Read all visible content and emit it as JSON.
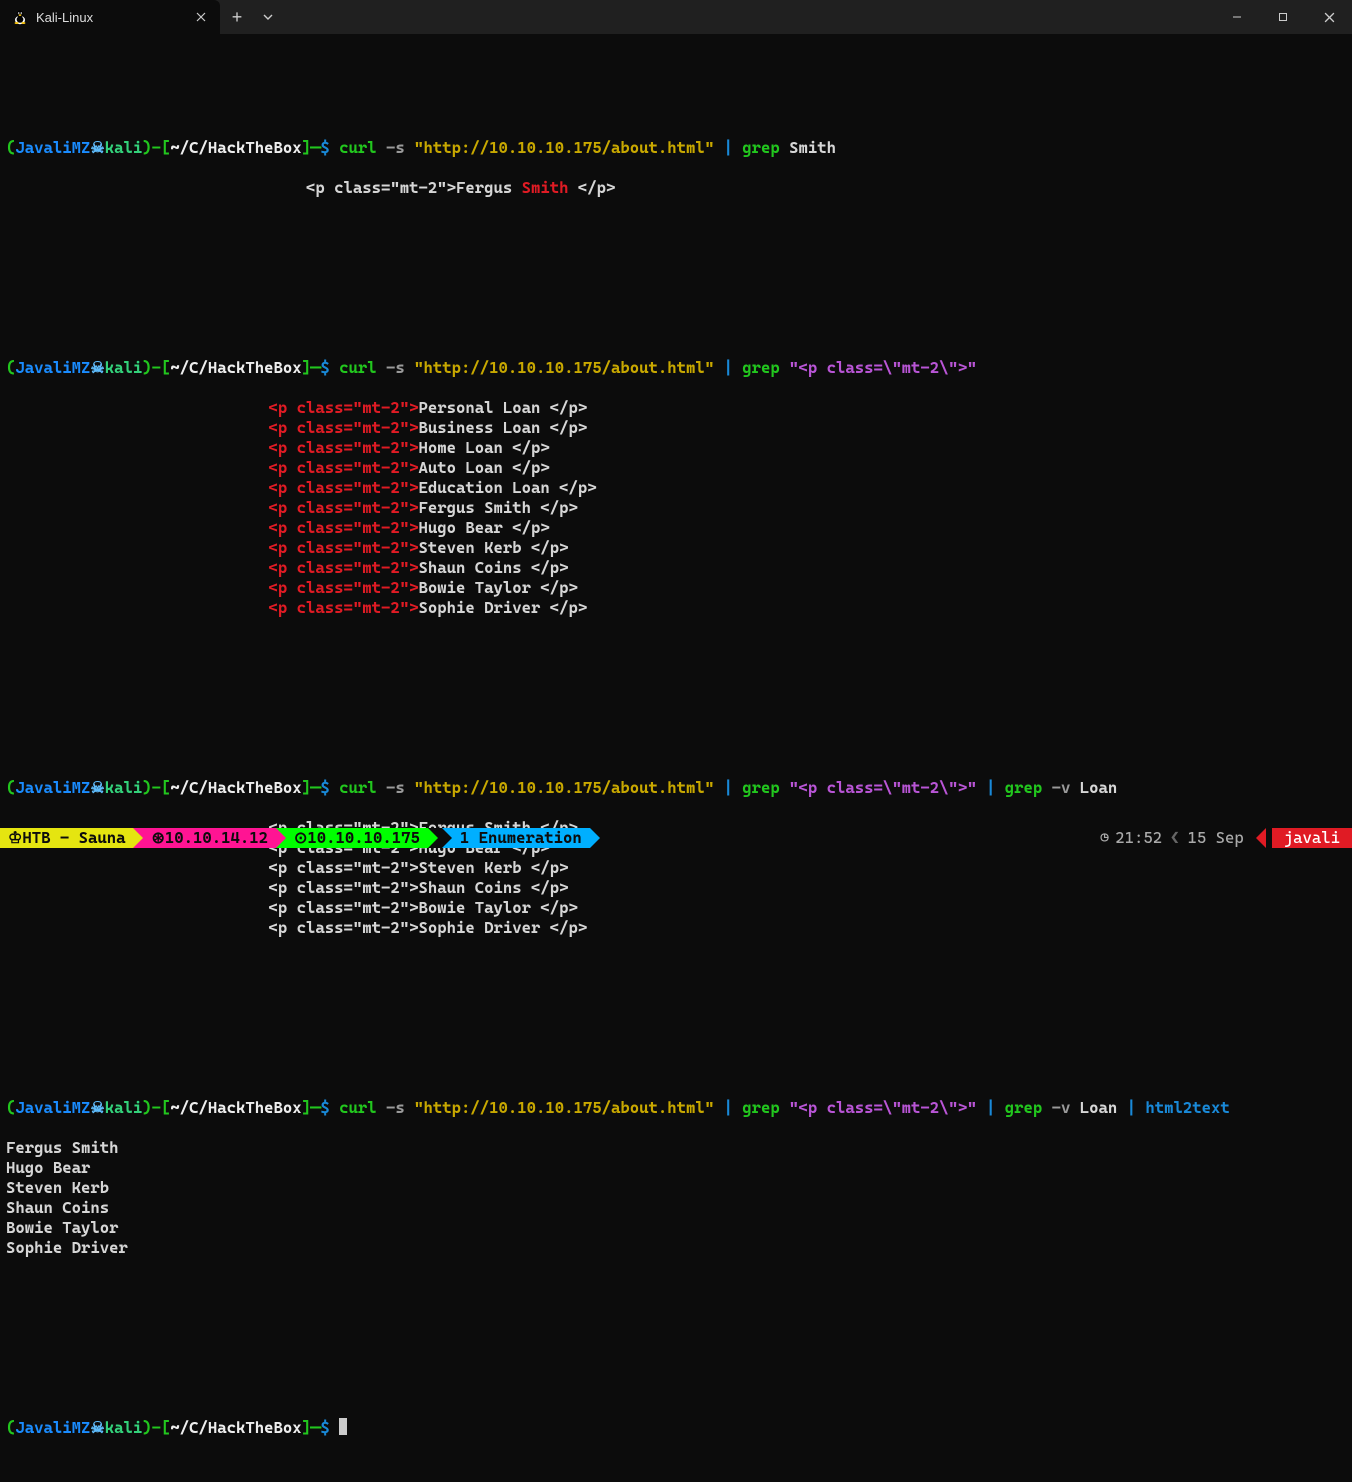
{
  "window": {
    "tab_title": "Kali-Linux"
  },
  "prompt": {
    "user": "JavaliMZ",
    "host": "kali",
    "path": "~/C/HackTheBox"
  },
  "colors": {
    "green": "#22c71e",
    "blue": "#1a8cff",
    "lightblue": "#5fbdfd",
    "yellow": "#c8a800",
    "red": "#e01b24",
    "pipe": "#1989d8",
    "magenta": "#b955d6"
  },
  "url": "\"http://10.10.10.175/about.html\"",
  "grep_class": "\"<p class=\\\"mt-2\\\">\"",
  "loan_word": "Loan",
  "smith_word": "Smith",
  "html2text": "html2text",
  "cmd_curl": "curl",
  "flag_s": "-s",
  "cmd_grep": "grep",
  "flag_v": "-v",
  "blocks": [
    {
      "command_parts": [
        "curl -s URL | grep Smith"
      ],
      "indent": "                                ",
      "output_colored": [
        {
          "pre": "<p class=\"mt-2\">Fergus ",
          "hl": "Smith",
          "post": " </p>"
        }
      ]
    },
    {
      "command_parts": [
        "curl -s URL | grep CLASS"
      ],
      "indent": "                            ",
      "output_tag": [
        "Personal Loan </p>",
        "Business Loan </p>",
        "Home Loan </p>",
        "Auto Loan </p>",
        "Education Loan </p>",
        "Fergus Smith </p>",
        "Hugo Bear </p>",
        "Steven Kerb </p>",
        "Shaun Coins </p>",
        "Bowie Taylor </p>",
        "Sophie Driver </p>"
      ]
    },
    {
      "command_parts": [
        "curl -s URL | grep CLASS | grep -v Loan"
      ],
      "indent": "                            ",
      "output_plain": [
        "<p class=\"mt-2\">Fergus Smith </p>",
        "<p class=\"mt-2\">Hugo Bear </p>",
        "<p class=\"mt-2\">Steven Kerb </p>",
        "<p class=\"mt-2\">Shaun Coins </p>",
        "<p class=\"mt-2\">Bowie Taylor </p>",
        "<p class=\"mt-2\">Sophie Driver </p>"
      ]
    },
    {
      "command_parts": [
        "curl -s URL | grep CLASS | grep -v Loan | html2text"
      ],
      "output_plain_noindent": [
        "Fergus Smith",
        "Hugo Bear",
        "Steven Kerb",
        "Shaun Coins",
        "Bowie Taylor",
        "Sophie Driver"
      ]
    }
  ],
  "tag_prefix_red": "<p class=\"mt-2\">",
  "tmux": {
    "left1": " HTB - Sauna",
    "left1_icon": "♔",
    "left2": "10.10.14.12",
    "left2_icon": "⊛",
    "left3": "10.10.10.175",
    "left3_icon": "⊙",
    "window": "1 Enumeration",
    "clock_icon": "◷",
    "time": "21:52",
    "date": "15 Sep",
    "user": "javali"
  }
}
